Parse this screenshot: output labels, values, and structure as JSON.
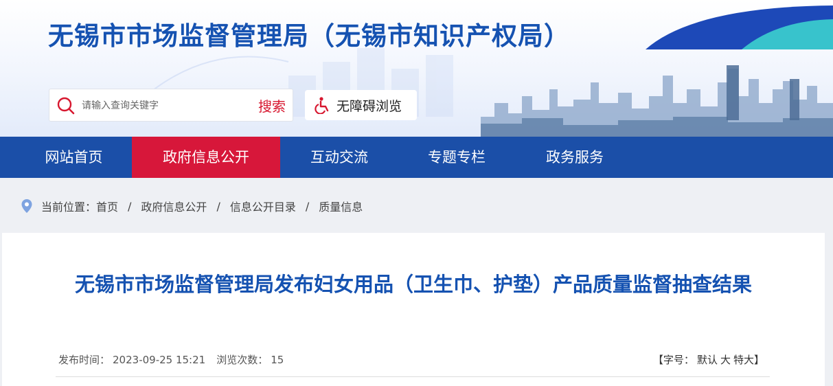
{
  "header": {
    "site_title": "无锡市市场监督管理局（无锡市知识产权局）",
    "search": {
      "placeholder": "请输入查询关键字",
      "button_label": "搜索"
    },
    "accessibility_label": "无障碍浏览"
  },
  "nav": {
    "items": [
      {
        "label": "网站首页",
        "active": false
      },
      {
        "label": "政府信息公开",
        "active": true
      },
      {
        "label": "互动交流",
        "active": false
      },
      {
        "label": "专题专栏",
        "active": false
      },
      {
        "label": "政务服务",
        "active": false
      }
    ]
  },
  "breadcrumb": {
    "prefix": "当前位置：",
    "items": [
      "首页",
      "政府信息公开",
      "信息公开目录",
      "质量信息"
    ],
    "separator": "/"
  },
  "article": {
    "title": "无锡市市场监督管理局发布妇女用品（卫生巾、护垫）产品质量监督抽查结果",
    "publish_label": "发布时间：",
    "publish_time": "2023-09-25 15:21",
    "views_label": "浏览次数：",
    "views": "15",
    "fontsize_open": "【字号：",
    "fontsize_default": "默认",
    "fontsize_large": "大",
    "fontsize_xlarge": "特大",
    "fontsize_close": "】"
  },
  "colors": {
    "brand_blue": "#1552b1",
    "nav_blue": "#1b4fa8",
    "active_red": "#d7173a",
    "search_red": "#d7172f"
  }
}
